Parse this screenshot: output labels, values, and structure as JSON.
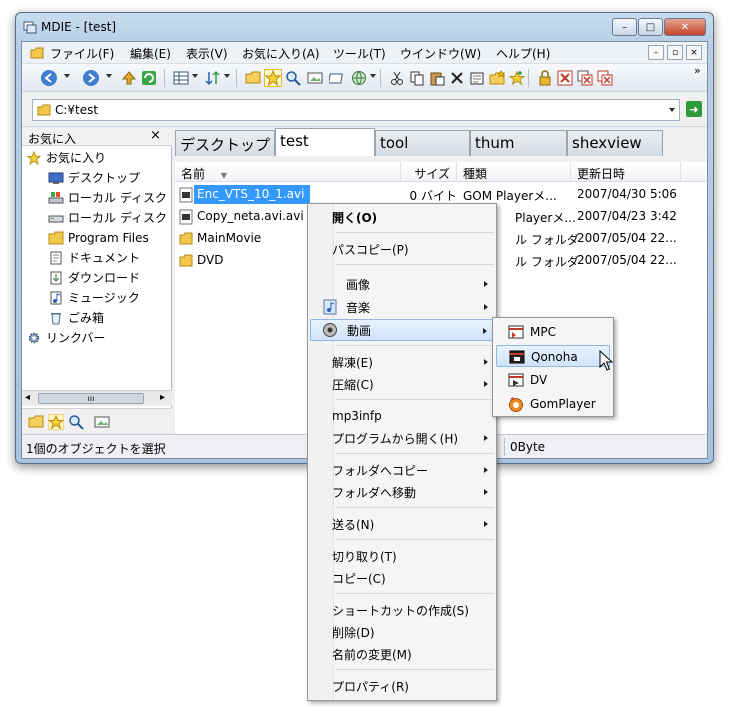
{
  "window": {
    "title": "MDIE - [test]",
    "caption_buttons": [
      "–",
      "□",
      "✕"
    ]
  },
  "menu": {
    "items": [
      "ファイル(F)",
      "編集(E)",
      "表示(V)",
      "お気に入り(A)",
      "ツール(T)",
      "ウインドウ(W)",
      "ヘルプ(H)"
    ],
    "mdi_buttons": [
      "–",
      "▫",
      "×"
    ]
  },
  "toolbar": {
    "overflow": "»"
  },
  "address": {
    "value": "C:¥test",
    "go_icon": "➜"
  },
  "left_pane": {
    "title": "お気に入",
    "close": "×",
    "tree": [
      {
        "label": "お気に入り",
        "icon": "star-icon"
      },
      {
        "label": "デスクトップ",
        "icon": "desktop-icon"
      },
      {
        "label": "ローカル ディスク",
        "icon": "disk-icon"
      },
      {
        "label": "ローカル ディスク",
        "icon": "disk-icon"
      },
      {
        "label": "Program Files",
        "icon": "folder-icon"
      },
      {
        "label": "ドキュメント",
        "icon": "documents-icon"
      },
      {
        "label": "ダウンロード",
        "icon": "downloads-icon"
      },
      {
        "label": "ミュージック",
        "icon": "music-icon"
      },
      {
        "label": "ごみ箱",
        "icon": "recycle-bin-icon"
      },
      {
        "label": "リンクバー",
        "icon": "gear-icon"
      }
    ],
    "scroll_left": "◂",
    "scroll_right": "▸",
    "scroll_grip": "ııı"
  },
  "tabs": [
    "デスクトップ",
    "test",
    "tool",
    "thum",
    "shexview"
  ],
  "file_list": {
    "columns": [
      "名前",
      "サイズ",
      "種類",
      "更新日時"
    ],
    "rows": [
      {
        "name": "Enc_VTS_10_1.avi",
        "size": "0 バイト",
        "type": "GOM Playerメ...",
        "date": "2007/04/30 5:06"
      },
      {
        "name": "Copy_neta.avi.avi",
        "size": "",
        "type": "Playerメ...",
        "date": "2007/04/23 3:42"
      },
      {
        "name": "MainMovie",
        "size": "",
        "type": "ル フォルダ",
        "date": "2007/05/04 22..."
      },
      {
        "name": "DVD",
        "size": "",
        "type": "ル フォルダ",
        "date": "2007/05/04 22..."
      }
    ]
  },
  "status": {
    "left": "1個のオブジェクトを選択",
    "right": "0Byte"
  },
  "context_menu": {
    "open": "開く(O)",
    "path_copy": "パスコピー(P)",
    "image": "画像",
    "music": "音楽",
    "video": "動画",
    "extract": "解凍(E)",
    "compress": "圧縮(C)",
    "mp3infp": "mp3infp",
    "open_with": "プログラムから開く(H)",
    "copy_to_folder": "フォルダへコピー",
    "move_to_folder": "フォルダへ移動",
    "send_to": "送る(N)",
    "cut": "切り取り(T)",
    "copy": "コピー(C)",
    "create_shortcut": "ショートカットの作成(S)",
    "delete": "削除(D)",
    "rename": "名前の変更(M)",
    "properties": "プロパティ(R)"
  },
  "submenu": {
    "items": [
      "MPC",
      "Qonoha",
      "DV",
      "GomPlayer"
    ]
  }
}
